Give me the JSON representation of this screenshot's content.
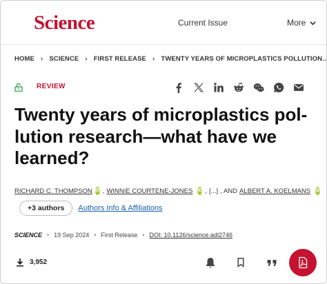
{
  "header": {
    "logo": "Science",
    "current_issue": "Current Issue",
    "more": "More"
  },
  "breadcrumb": [
    "HOME",
    "SCIENCE",
    "FIRST RELEASE",
    "TWENTY YEARS OF MICROPLASTICS POLLUTION…"
  ],
  "article": {
    "type": "REVIEW",
    "title": "Twenty years of microplastics pol-lution research—what have we learned?",
    "authors": [
      "RICHARD C. THOMPSON",
      "WINNIE COURTENE-JONES",
      "ALBERT A. KOELMANS"
    ],
    "author_sep_1": ",",
    "author_ellipsis": "[...]",
    "author_and": ", AND",
    "more_authors": "+3 authors",
    "affiliations_link": "Authors Info & Affiliations",
    "journal": "SCIENCE",
    "date": "19 Sep 2024",
    "status": "First Release",
    "doi": "DOI: 10.1126/science.adl2746",
    "downloads": "3,952"
  },
  "share_icons": [
    "facebook-icon",
    "x-icon",
    "linkedin-icon",
    "reddit-icon",
    "wechat-icon",
    "whatsapp-icon",
    "email-icon"
  ],
  "colors": {
    "brand": "#c41230",
    "orcid": "#a6ce39",
    "link": "#1a5fa8"
  }
}
